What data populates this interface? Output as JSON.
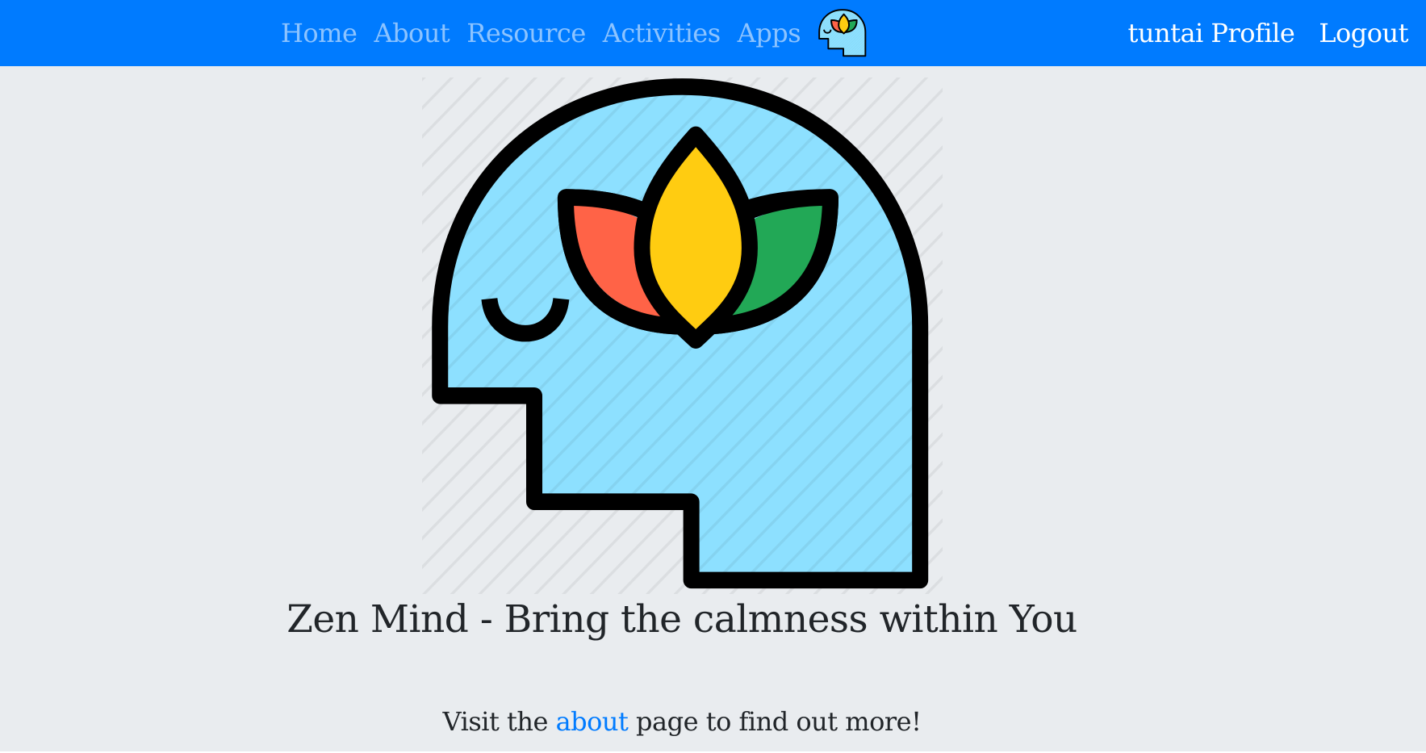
{
  "nav": {
    "links": [
      "Home",
      "About",
      "Resource",
      "Activities",
      "Apps"
    ],
    "logo_icon": "zen-head-lotus-icon",
    "profile_label": "tuntai Profile",
    "logout_label": "Logout"
  },
  "hero": {
    "image_icon": "zen-head-lotus-icon",
    "title": "Zen Mind - Bring the calmness within You",
    "text_before": "Visit the ",
    "link_text": "about",
    "text_after": " page to find out more!"
  },
  "colors": {
    "navbar": "#007bff",
    "page_background": "#e9ecef",
    "head_fill": "#8de0ff",
    "petal_red": "#ff6347",
    "petal_yellow": "#ffcc11",
    "petal_green": "#22a856",
    "outline": "#000000",
    "link": "#007bff"
  }
}
